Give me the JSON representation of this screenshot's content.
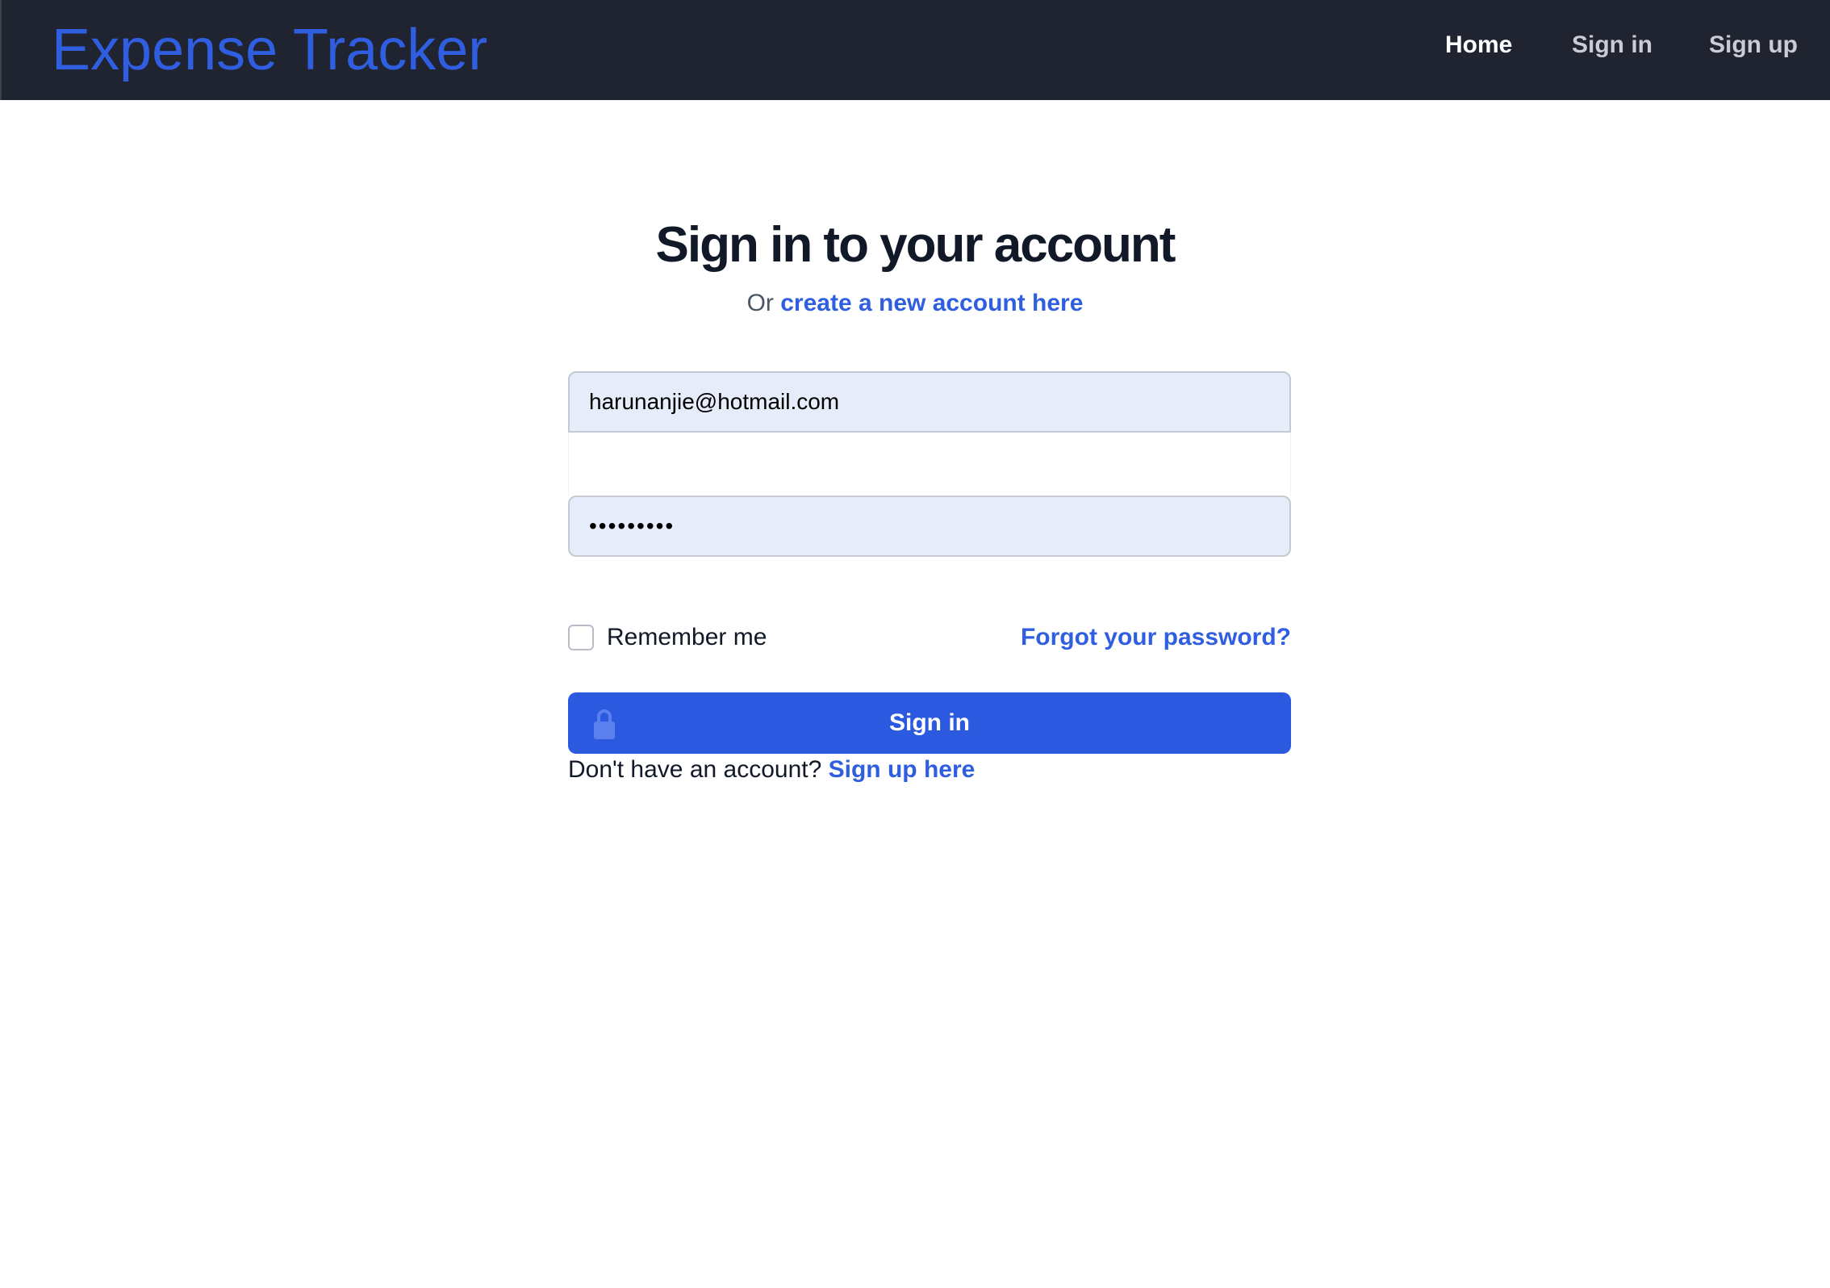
{
  "navbar": {
    "brand": "Expense Tracker",
    "links": {
      "home": "Home",
      "sign_in": "Sign in",
      "sign_up": "Sign up"
    },
    "background": "#1f2430",
    "brand_color": "#2f5ee0"
  },
  "form": {
    "title": "Sign in to your account",
    "subtitle_prefix": "Or",
    "create_account_link": "create a new account here",
    "email_value": "harunanjie@hotmail.com",
    "password_value": "•••••••••",
    "remember_me_label": "Remember me",
    "remember_me_checked": false,
    "forgot_password_link": "Forgot your password?",
    "submit_label": "Sign in",
    "no_account_text": "Don't have an account?",
    "sign_up_link": "Sign up here",
    "accent_color": "#2b59e0",
    "input_fill_color": "#e7ecfb"
  },
  "icons": {
    "submit_icon": "lock-icon"
  }
}
